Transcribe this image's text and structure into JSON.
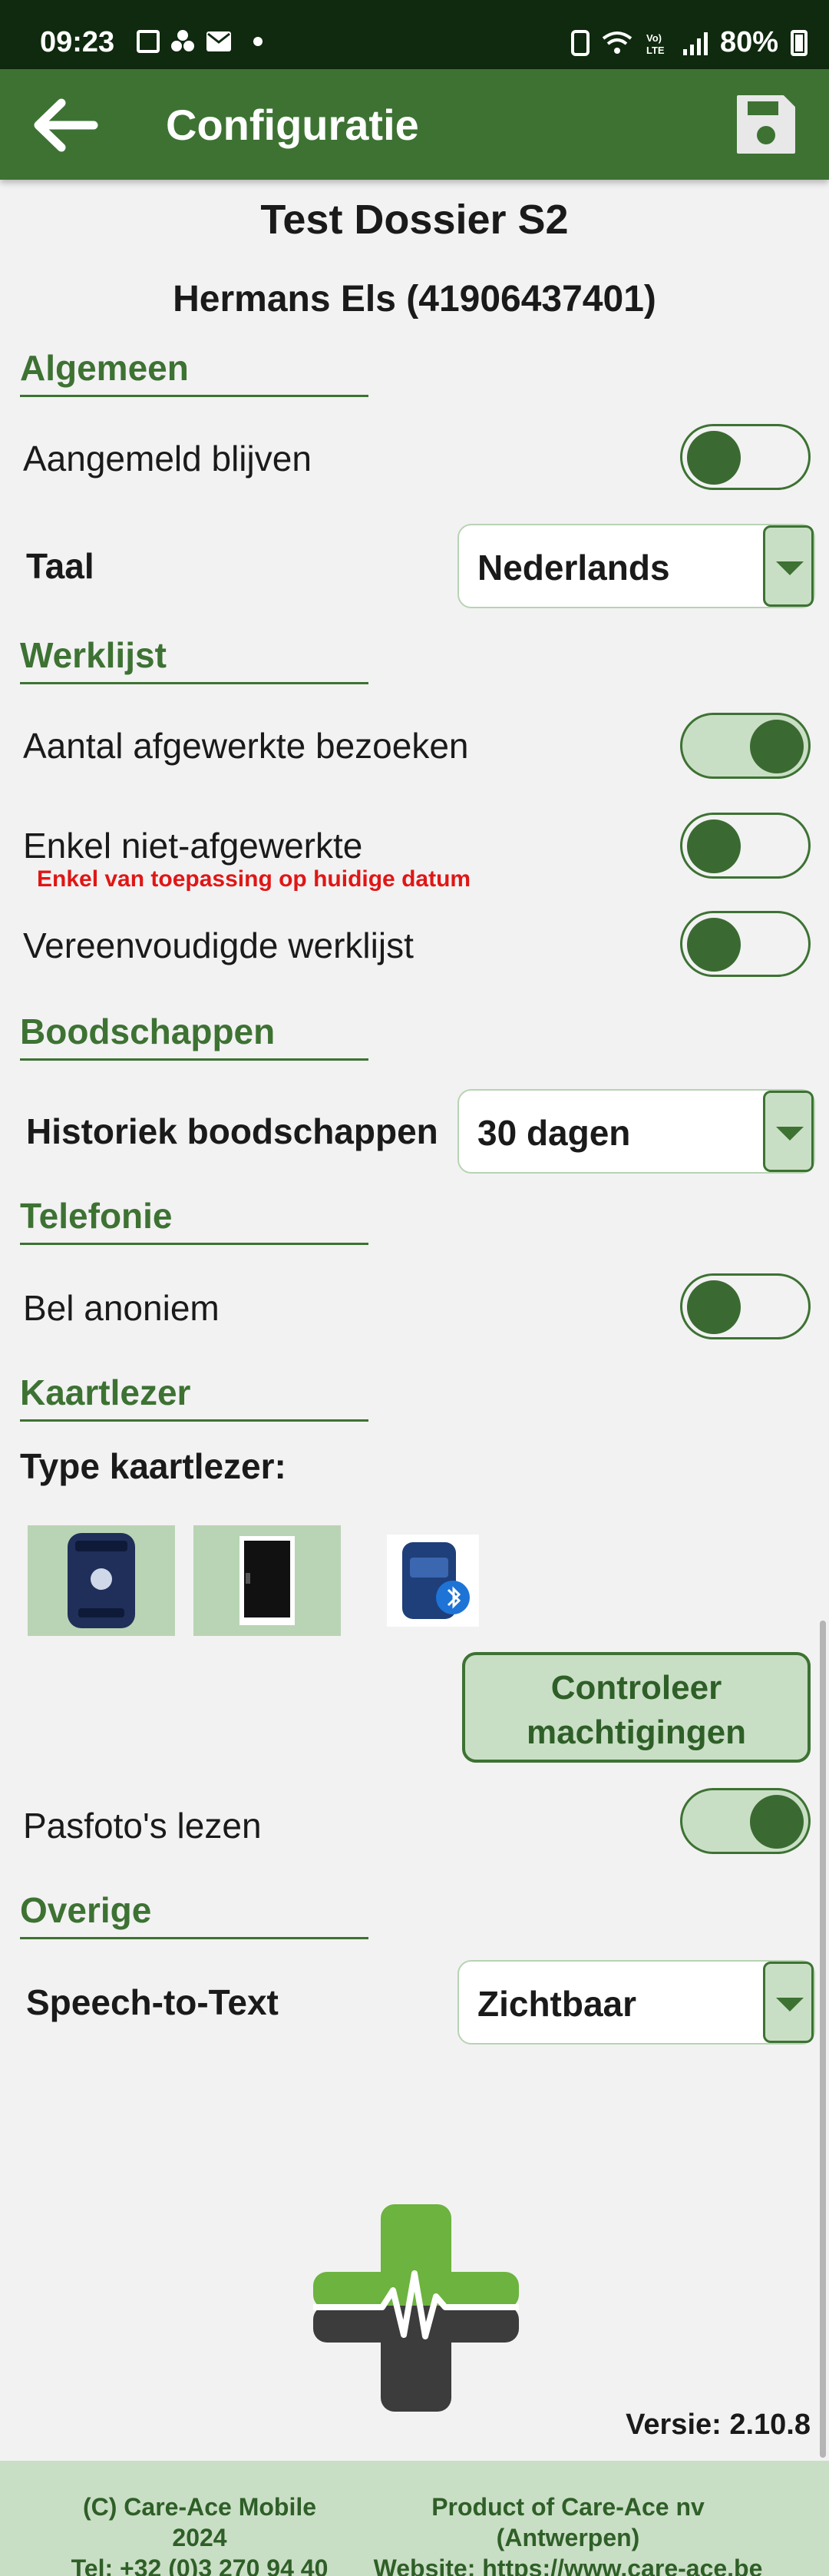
{
  "status_bar": {
    "time": "09:23",
    "battery": "80%"
  },
  "app_bar": {
    "title": "Configuratie",
    "back_icon": "arrow-left-icon",
    "save_icon": "floppy-disk-icon"
  },
  "dossier": {
    "title": "Test Dossier S2",
    "patient": "Hermans Els (41906437401)"
  },
  "sections": {
    "algemeen": {
      "title": "Algemeen",
      "stay_logged_in": {
        "label": "Aangemeld blijven",
        "on": false
      },
      "language": {
        "label": "Taal",
        "value": "Nederlands"
      }
    },
    "werklijst": {
      "title": "Werklijst",
      "count_completed": {
        "label": "Aantal afgewerkte bezoeken",
        "on": true
      },
      "only_uncompleted": {
        "label": "Enkel niet-afgewerkte",
        "note": "Enkel van toepassing op huidige datum",
        "on": false
      },
      "simplified": {
        "label": "Vereenvoudigde werklijst",
        "on": false
      }
    },
    "boodschappen": {
      "title": "Boodschappen",
      "history": {
        "label": "Historiek boodschappen",
        "value": "30 dagen"
      }
    },
    "telefonie": {
      "title": "Telefonie",
      "anonymous": {
        "label": "Bel anoniem",
        "on": false
      }
    },
    "kaartlezer": {
      "title": "Kaartlezer",
      "type_label": "Type kaartlezer:",
      "check_button": {
        "line1": "Controleer",
        "line2": "machtigingen"
      },
      "photos": {
        "label": "Pasfoto's lezen",
        "on": true
      }
    },
    "overige": {
      "title": "Overige",
      "speech": {
        "label": "Speech-to-Text",
        "value": "Zichtbaar"
      }
    }
  },
  "version": "Versie: 2.10.8",
  "footer": {
    "copyright": "(C) Care-Ace Mobile 2024",
    "tel": "Tel: +32 (0)3 270 94 40",
    "product": "Product of Care-Ace nv (Antwerpen)",
    "website": "Website: https://www.care-ace.be"
  },
  "colors": {
    "primary": "#3d7233",
    "status_bar": "#0f2a0e",
    "light_green": "#c9dfc5",
    "warning": "#e01616"
  }
}
